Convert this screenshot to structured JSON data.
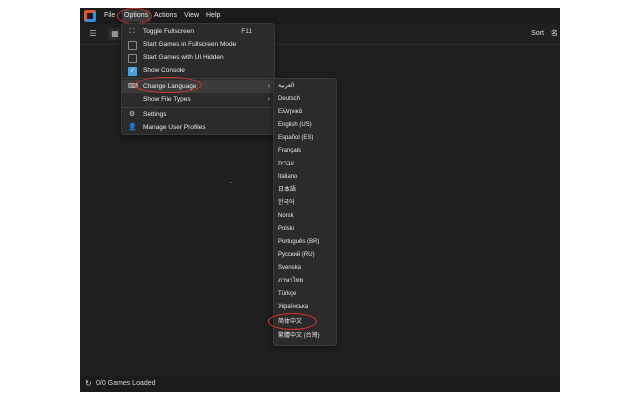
{
  "menubar": {
    "items": [
      "File",
      "Options",
      "Actions",
      "View",
      "Help"
    ]
  },
  "toolbar": {
    "sort_label": "Sort",
    "sort_icon_glyph": "名"
  },
  "options_menu": {
    "items": [
      {
        "label": "Toggle Fullscreen",
        "shortcut": "F11",
        "icon": "fullscreen-icon"
      },
      {
        "label": "Start Games in Fullscreen Mode",
        "icon": "checkbox-unchecked"
      },
      {
        "label": "Start Games with UI Hidden",
        "icon": "checkbox-unchecked"
      },
      {
        "label": "Show Console",
        "icon": "checkbox-checked"
      },
      {
        "label": "Change Language",
        "icon": "language-icon",
        "submenu": true
      },
      {
        "label": "Show File Types",
        "submenu": true
      },
      {
        "label": "Settings",
        "icon": "gear-icon"
      },
      {
        "label": "Manage User Profiles",
        "icon": "user-icon"
      }
    ]
  },
  "languages": [
    "العربية",
    "Deutsch",
    "Ελληνικά",
    "English (US)",
    "Español (ES)",
    "Français",
    "עברית",
    "Italiano",
    "日本語",
    "한국어",
    "Norsk",
    "Polski",
    "Português (BR)",
    "Русский (RU)",
    "Svenska",
    "ภาษาไทย",
    "Türkçe",
    "Українська",
    "简体中文",
    "繁體中文 (台灣)"
  ],
  "status": {
    "text": "0/0 Games Loaded"
  },
  "colors": {
    "highlight_ring": "#d9312b",
    "check_accent": "#4aa3e0"
  }
}
